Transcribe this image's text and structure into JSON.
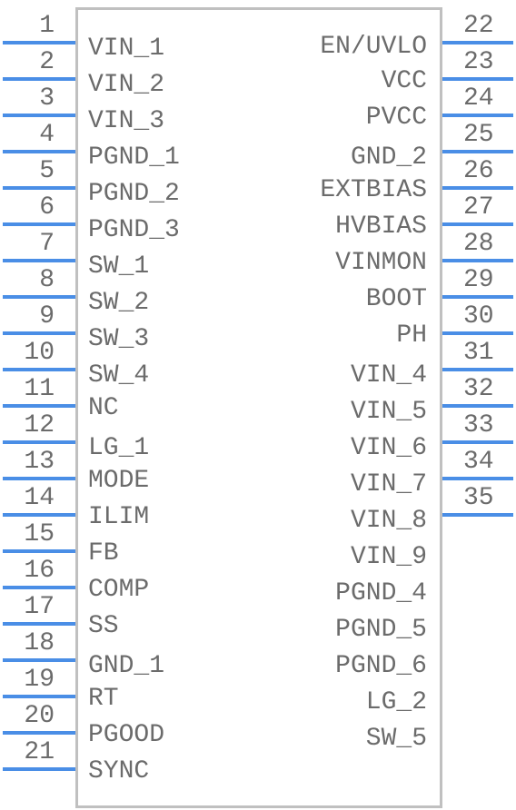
{
  "component": {
    "left_pins": [
      {
        "num": "1",
        "label": "VIN_1"
      },
      {
        "num": "2",
        "label": "VIN_2"
      },
      {
        "num": "3",
        "label": "VIN_3"
      },
      {
        "num": "4",
        "label": "PGND_1"
      },
      {
        "num": "5",
        "label": "PGND_2"
      },
      {
        "num": "6",
        "label": "PGND_3"
      },
      {
        "num": "7",
        "label": "SW_1"
      },
      {
        "num": "8",
        "label": "SW_2"
      },
      {
        "num": "9",
        "label": "SW_3"
      },
      {
        "num": "10",
        "label": "SW_4"
      },
      {
        "num": "11",
        "label": "NC"
      },
      {
        "num": "12",
        "label": "LG_1"
      },
      {
        "num": "13",
        "label": "MODE"
      },
      {
        "num": "14",
        "label": "ILIM"
      },
      {
        "num": "15",
        "label": "FB"
      },
      {
        "num": "16",
        "label": "COMP"
      },
      {
        "num": "17",
        "label": "SS"
      },
      {
        "num": "18",
        "label": "GND_1"
      },
      {
        "num": "19",
        "label": "RT"
      },
      {
        "num": "20",
        "label": "PGOOD"
      },
      {
        "num": "21",
        "label": "SYNC"
      }
    ],
    "right_pins": [
      {
        "num": "22",
        "label": "EN/UVLO"
      },
      {
        "num": "23",
        "label": "VCC"
      },
      {
        "num": "24",
        "label": "PVCC"
      },
      {
        "num": "25",
        "label": "GND_2"
      },
      {
        "num": "26",
        "label": "EXTBIAS"
      },
      {
        "num": "27",
        "label": "HVBIAS"
      },
      {
        "num": "28",
        "label": "VINMON"
      },
      {
        "num": "29",
        "label": "BOOT"
      },
      {
        "num": "30",
        "label": "PH"
      },
      {
        "num": "31",
        "label": "VIN_4"
      },
      {
        "num": "32",
        "label": "VIN_5"
      },
      {
        "num": "33",
        "label": "VIN_6"
      },
      {
        "num": "34",
        "label": "VIN_7"
      },
      {
        "num": "35",
        "label": "VIN_8"
      }
    ],
    "right_labels_extra": [
      "VIN_9",
      "PGND_4",
      "PGND_5",
      "PGND_6",
      "LG_2",
      "SW_5"
    ],
    "colors": {
      "pin": "#4a8ee6",
      "outline": "#c0c0c0",
      "text": "#6b6b6b"
    }
  }
}
